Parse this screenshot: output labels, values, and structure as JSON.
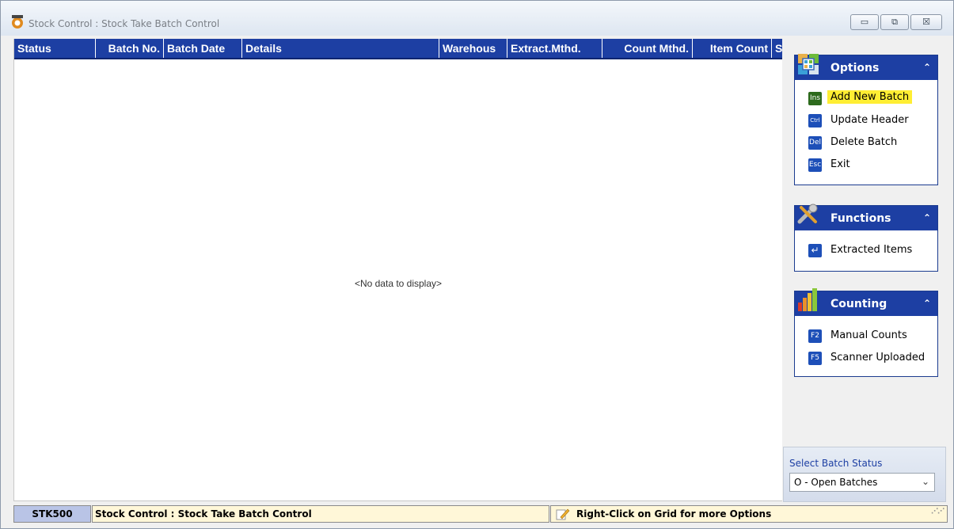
{
  "window": {
    "title": "Stock Control : Stock Take Batch Control",
    "controls": {
      "minimize": "▭",
      "maximize": "⧉",
      "close": "☒"
    }
  },
  "grid": {
    "columns": [
      "Status",
      "Batch No.",
      "Batch Date",
      "Details",
      "Warehous",
      "Extract.Mthd.",
      "Count Mthd.",
      "Item Count",
      "S"
    ],
    "empty_message": "<No data to display>"
  },
  "panel": {
    "options": {
      "title": "Options",
      "items": [
        {
          "key": "Ins",
          "label": "Add New Batch",
          "highlighted": true
        },
        {
          "key": "Ctrl",
          "label": "Update Header"
        },
        {
          "key": "Del",
          "label": "Delete Batch"
        },
        {
          "key": "Esc",
          "label": "Exit"
        }
      ]
    },
    "functions": {
      "title": "Functions",
      "items": [
        {
          "key": "↵",
          "label": "Extracted Items"
        }
      ]
    },
    "counting": {
      "title": "Counting",
      "items": [
        {
          "key": "F2",
          "label": "Manual Counts"
        },
        {
          "key": "F5",
          "label": "Scanner Uploaded"
        }
      ]
    },
    "batch_status": {
      "caption": "Select Batch Status",
      "value": "O - Open Batches"
    }
  },
  "statusbar": {
    "code": "STK500",
    "title": "Stock Control : Stock Take Batch Control",
    "hint": "Right-Click on Grid for more Options"
  },
  "colors": {
    "header_blue": "#1d3fa3",
    "highlight": "#ffee33",
    "status_bg": "#fff7d8"
  }
}
